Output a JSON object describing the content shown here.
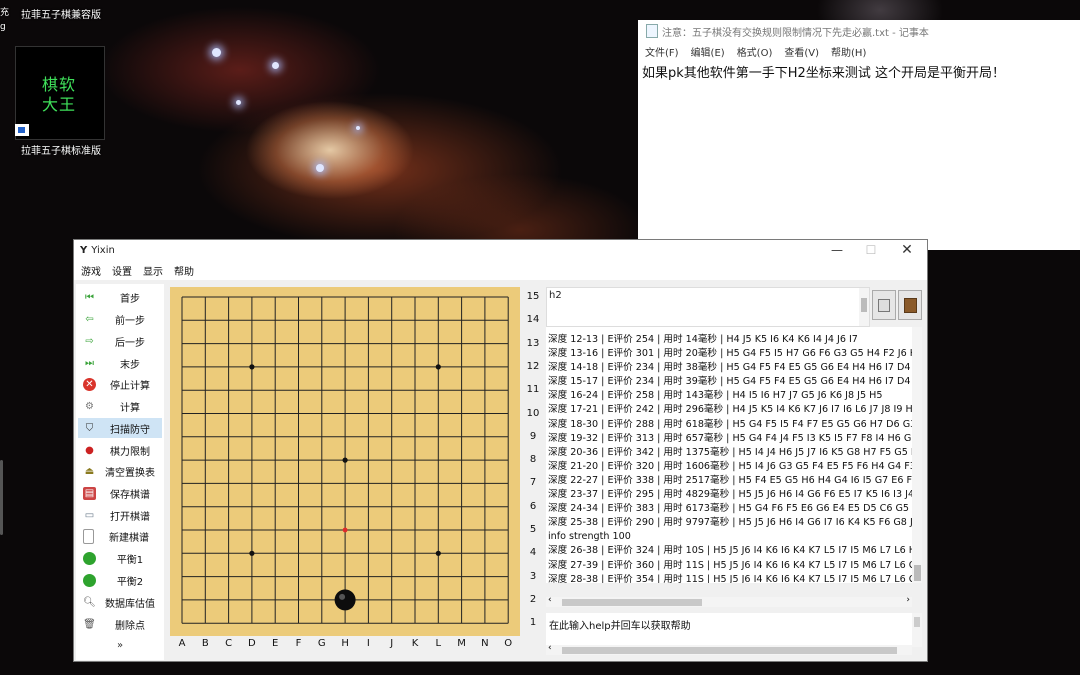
{
  "desktop": {
    "icon1_label": "拉菲五子棋兼容版",
    "icon2_label": "拉菲五子棋标准版",
    "icon2_chars": [
      "棋软",
      "大王"
    ],
    "left_edge_chars": [
      "充",
      "g"
    ]
  },
  "notepad": {
    "title": "注意：五子棋没有交换规则限制情况下先走必赢.txt - 记事本",
    "menu": [
      "文件(F)",
      "编辑(E)",
      "格式(O)",
      "查看(V)",
      "帮助(H)"
    ],
    "text": "如果pk其他软件第一手下H2坐标来测试 这个开局是平衡开局！"
  },
  "yixin": {
    "title": "Yixin",
    "menu": [
      "游戏",
      "设置",
      "显示",
      "帮助"
    ],
    "sidebar": [
      {
        "label": "首步",
        "icon": "first-move-icon"
      },
      {
        "label": "前一步",
        "icon": "prev-move-icon"
      },
      {
        "label": "后一步",
        "icon": "next-move-icon"
      },
      {
        "label": "末步",
        "icon": "last-move-icon"
      },
      {
        "label": "停止计算",
        "icon": "stop-icon"
      },
      {
        "label": "计算",
        "icon": "compute-icon"
      },
      {
        "label": "扫描防守",
        "icon": "shield-icon"
      },
      {
        "label": "棋力限制",
        "icon": "strength-limit-icon"
      },
      {
        "label": "清空置换表",
        "icon": "clear-table-icon"
      },
      {
        "label": "保存棋谱",
        "icon": "save-icon"
      },
      {
        "label": "打开棋谱",
        "icon": "folder-icon"
      },
      {
        "label": "新建棋谱",
        "icon": "new-file-icon"
      },
      {
        "label": "平衡1",
        "icon": "balance1-icon"
      },
      {
        "label": "平衡2",
        "icon": "balance2-icon"
      },
      {
        "label": "数据库估值",
        "icon": "magnifier-icon"
      },
      {
        "label": "删除点",
        "icon": "trash-icon"
      }
    ],
    "more": "»",
    "board": {
      "columns": [
        "A",
        "B",
        "C",
        "D",
        "E",
        "F",
        "G",
        "H",
        "I",
        "J",
        "K",
        "L",
        "M",
        "N",
        "O"
      ],
      "rows": [
        "15",
        "14",
        "13",
        "12",
        "11",
        "10",
        "9",
        "8",
        "7",
        "6",
        "5",
        "4",
        "3",
        "2",
        "1"
      ],
      "stone": {
        "color": "black",
        "at": "H2"
      },
      "last_move_marker": "H5"
    },
    "command_text": "h2",
    "log": [
      "深度 12-13 | E评价 254 | 用时 14毫秒 | H4 J5 K5 I6 K4 K6 I4 J4 J6 I7",
      "深度 13-16 | E评价 301 | 用时 20毫秒 | H5 G4 F5 I5 H7 G6 F6 G3 G5 H4 F2 J6 K7",
      "深度 14-18 | E评价 234 | 用时 38毫秒 | H5 G4 F5 F4 E5 G5 G6 E4 H4 H6 I7 D4 C",
      "深度 15-17 | E评价 234 | 用时 39毫秒 | H5 G4 F5 F4 E5 G5 G6 E4 H4 H6 I7 D4 C",
      "深度 16-24 | E评价 258 | 用时 143毫秒 | H4 I5 I6 H7 J7 G5 J6 K6 J8 J5 H5",
      "深度 17-21 | E评价 242 | 用时 296毫秒 | H4 J5 K5 I4 K6 K7 J6 I7 I6 L6 J7 J8 I9 H",
      "深度 18-30 | E评价 288 | 用时 618毫秒 | H5 G4 F5 I5 F4 F7 E5 G5 G6 H7 D6 G3 F",
      "深度 19-32 | E评价 313 | 用时 657毫秒 | H5 G4 F4 J4 F5 I3 K5 I5 F7 F8 I4 H6 G7",
      "深度 20-36 | E评价 342 | 用时 1375毫秒 | H5 I4 J4 H6 J5 J7 I6 K5 G8 H7 F5 G5 I",
      "深度 21-20 | E评价 320 | 用时 1606毫秒 | H5 I4 J6 G3 G5 F4 E5 F5 F6 H4 G4 F3 (",
      "深度 22-27 | E评价 338 | 用时 2517毫秒 | H5 F4 E5 G5 H6 H4 G4 I6 I5 G7 E6 F6",
      "深度 23-37 | E评价 295 | 用时 4829毫秒 | H5 J5 J6 H6 I4 G6 F6 E5 I7 K5 I6 I3 J4",
      "深度 24-34 | E评价 383 | 用时 6173毫秒 | H5 G4 F6 F5 E6 G6 E4 E5 D5 C6 G5 E7",
      "深度 25-38 | E评价 290 | 用时 9797毫秒 | H5 J5 J6 H6 I4 G6 I7 I6 K4 K5 F6 G8 J",
      "info strength 100",
      "深度 26-38 | E评价 324 | 用时 10S | H5 J5 J6 I4 K6 I6 K4 K7 L5 I7 I5 M6 L7 L6 H",
      "深度 27-39 | E评价 360 | 用时 11S | H5 J5 J6 I4 K6 I6 K4 K7 L5 I7 I5 M6 L7 L6 G",
      "深度 28-38 | E评价 354 | 用时 11S | H5 J5 J6 I4 K6 I6 K4 K7 L5 I7 I5 M6 L7 L6 G"
    ],
    "input_text": "在此输入help并回车以获取帮助"
  }
}
